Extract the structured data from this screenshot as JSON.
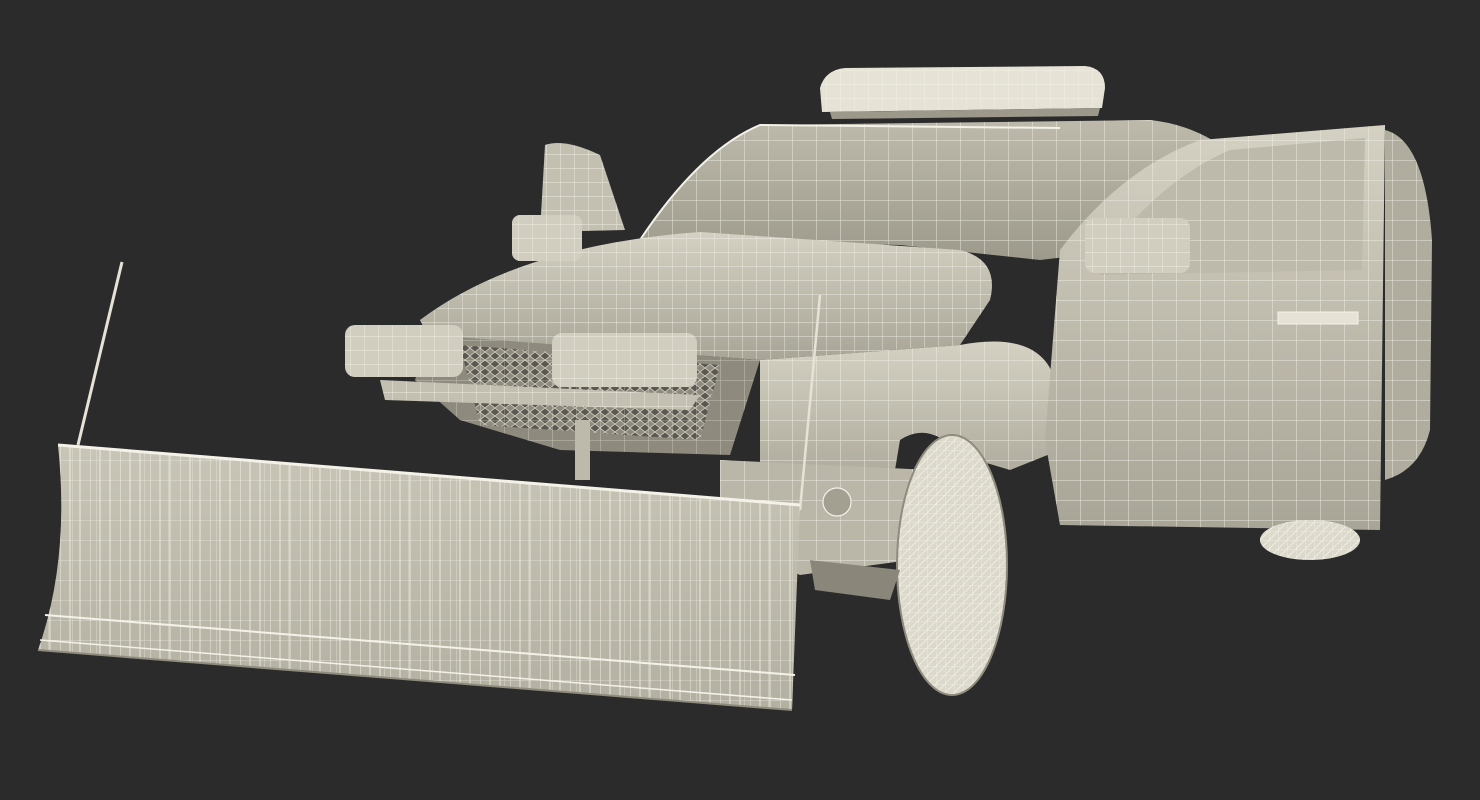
{
  "scene": {
    "background_color": "#2b2b2b",
    "model_fill_color": "#c9c6b8",
    "model_shade_color": "#a9a698",
    "wire_color": "#f4f2e8",
    "render_style": "wireframe-over-shaded",
    "subject_icon": "pickup-truck-with-snow-plow-icon"
  }
}
